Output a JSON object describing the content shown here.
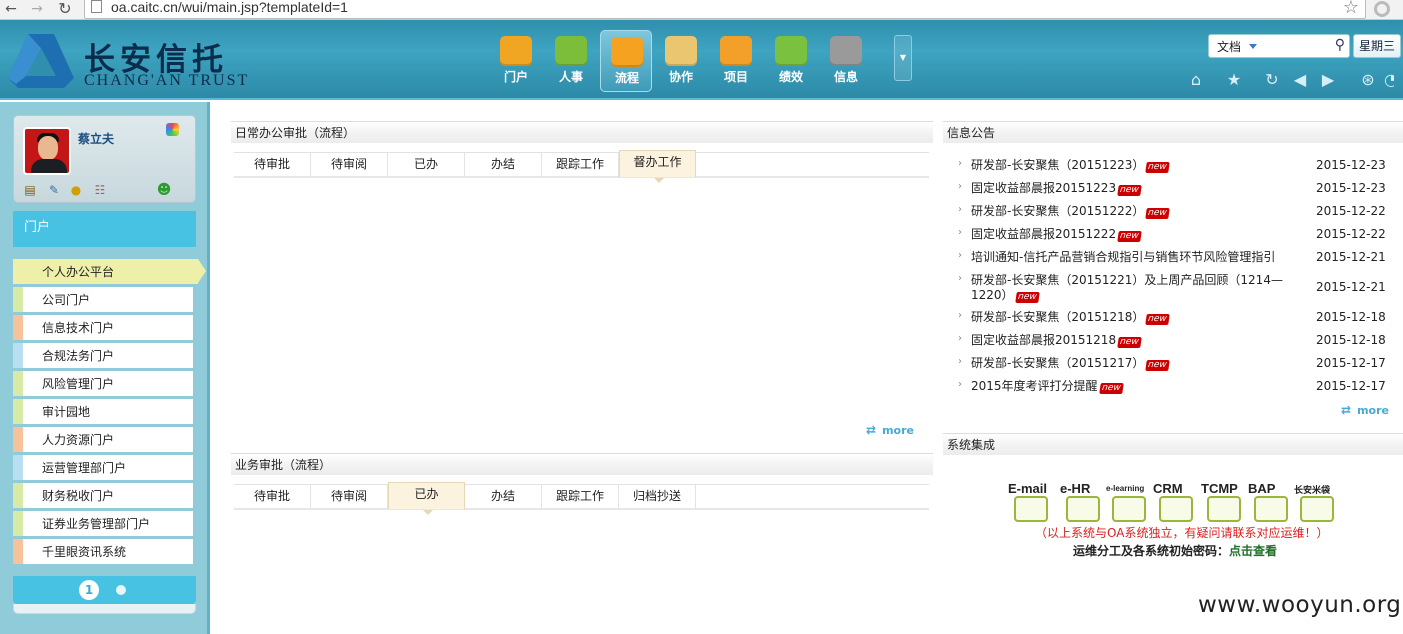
{
  "browser": {
    "url": "oa.caitc.cn/wui/main.jsp?templateId=1"
  },
  "logo": {
    "name_cn": "长安信托",
    "name_en": "CHANG'AN TRUST"
  },
  "modules": [
    {
      "label": "门户",
      "color": "#f0a623",
      "icon": "home-icon",
      "active": false
    },
    {
      "label": "人事",
      "color": "#7cbd3a",
      "icon": "personnel-icon",
      "active": false
    },
    {
      "label": "流程",
      "color": "#f4a21f",
      "icon": "workflow-chart-icon",
      "active": true
    },
    {
      "label": "协作",
      "color": "#e9c66f",
      "icon": "collaboration-icon",
      "active": false
    },
    {
      "label": "项目",
      "color": "#f3a02a",
      "icon": "project-icon",
      "active": false
    },
    {
      "label": "绩效",
      "color": "#79c13f",
      "icon": "performance-icon",
      "active": false
    },
    {
      "label": "信息",
      "color": "#9a9a9a",
      "icon": "globe-icon",
      "active": false
    }
  ],
  "search": {
    "type": "文档"
  },
  "weekday": "星期三",
  "user": {
    "name": "蔡立夫"
  },
  "portal_title": "门户",
  "nav_items": [
    {
      "label": "个人办公平台",
      "color": "active"
    },
    {
      "label": "公司门户",
      "color": "c-green"
    },
    {
      "label": "信息技术门户",
      "color": "c-orange"
    },
    {
      "label": "合规法务门户",
      "color": "c-blue"
    },
    {
      "label": "风险管理门户",
      "color": "c-green"
    },
    {
      "label": "审计园地",
      "color": "c-green"
    },
    {
      "label": "人力资源门户",
      "color": "c-orange"
    },
    {
      "label": "运营管理部门户",
      "color": "c-blue"
    },
    {
      "label": "财务税收门户",
      "color": "c-green"
    },
    {
      "label": "证券业务管理部门户",
      "color": "c-green"
    },
    {
      "label": "千里眼资讯系统",
      "color": "c-orange"
    }
  ],
  "pager": {
    "current": "1"
  },
  "daily_approval": {
    "title": "日常办公审批（流程）",
    "tabs": [
      "待审批",
      "待审阅",
      "已办",
      "办结",
      "跟踪工作",
      "督办工作"
    ],
    "active_tab": 5,
    "more": "more"
  },
  "business_approval": {
    "title": "业务审批（流程）",
    "tabs": [
      "待审批",
      "待审阅",
      "已办",
      "办结",
      "跟踪工作",
      "归档抄送"
    ],
    "active_tab": 2
  },
  "notices": {
    "title": "信息公告",
    "items": [
      {
        "title": "研发部-长安聚焦（20151223）",
        "date": "2015-12-23",
        "is_new": true
      },
      {
        "title": "固定收益部晨报20151223",
        "date": "2015-12-23",
        "is_new": true
      },
      {
        "title": "研发部-长安聚焦（20151222）",
        "date": "2015-12-22",
        "is_new": true
      },
      {
        "title": "固定收益部晨报20151222",
        "date": "2015-12-22",
        "is_new": true
      },
      {
        "title": "培训通知-信托产品营销合规指引与销售环节风险管理指引",
        "date": "2015-12-21",
        "is_new": false
      },
      {
        "title": "研发部-长安聚焦（20151221）及上周产品回顾（1214—1220）",
        "date": "2015-12-21",
        "is_new": true
      },
      {
        "title": "研发部-长安聚焦（20151218）",
        "date": "2015-12-18",
        "is_new": true
      },
      {
        "title": "固定收益部晨报20151218",
        "date": "2015-12-18",
        "is_new": true
      },
      {
        "title": "研发部-长安聚焦（20151217）",
        "date": "2015-12-17",
        "is_new": true
      },
      {
        "title": "2015年度考评打分提醒",
        "date": "2015-12-17",
        "is_new": true
      }
    ],
    "new_tag": "new",
    "more": "more"
  },
  "systems": {
    "title": "系统集成",
    "items": [
      "E-mail",
      "e-HR",
      "e-learning",
      "CRM",
      "TCMP",
      "BAP",
      "长安米袋"
    ],
    "note": "（以上系统与OA系统独立，有疑问请联系对应运维！）",
    "pwd_label": "运维分工及各系统初始密码：",
    "pwd_link": "点击查看"
  },
  "watermark": "www.wooyun.org"
}
